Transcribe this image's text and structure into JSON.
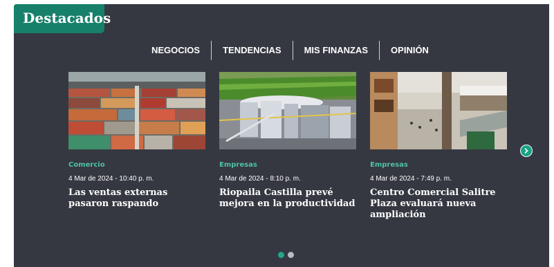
{
  "section": {
    "title": "Destacados"
  },
  "tabs": [
    {
      "label": "NEGOCIOS"
    },
    {
      "label": "TENDENCIAS"
    },
    {
      "label": "MIS FINANZAS"
    },
    {
      "label": "OPINIÓN"
    }
  ],
  "articles": [
    {
      "category": "Comercio",
      "date": "4 Mar de 2024 - 10:40 p. m.",
      "title": "Las ventas externas pasaron raspando",
      "image": "shipping-containers-photo"
    },
    {
      "category": "Empresas",
      "date": "4 Mar de 2024 - 8:10 p. m.",
      "title": "Riopaila Castilla prevé mejora en la productividad",
      "image": "industrial-plant-photo"
    },
    {
      "category": "Empresas",
      "date": "4 Mar de 2024 - 7:49 p. m.",
      "title": "Centro Comercial Salitre Plaza evaluará nueva ampliación",
      "image": "shopping-mall-photo"
    }
  ],
  "carousel": {
    "pages": 2,
    "active_page": 1,
    "next_icon": "chevron-right-icon"
  },
  "colors": {
    "panel_bg": "#353841",
    "accent": "#17806b",
    "category_text": "#4fc3a1",
    "dot_active": "#22a889",
    "dot_inactive": "#b7babf"
  }
}
